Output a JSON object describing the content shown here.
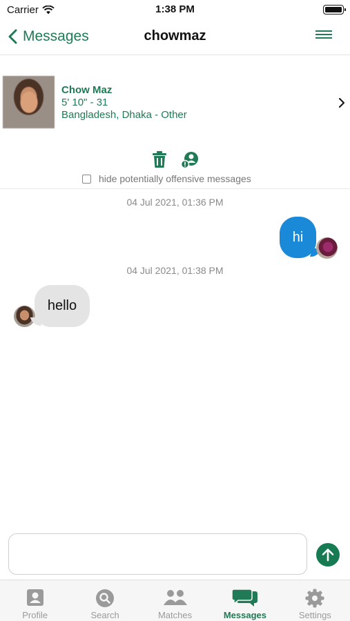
{
  "status_bar": {
    "carrier": "Carrier",
    "time": "1:38 PM"
  },
  "nav": {
    "back_label": "Messages",
    "title": "chowmaz"
  },
  "profile": {
    "name": "Chow Maz",
    "height_age": "5' 10\" - 31",
    "location": "Bangladesh, Dhaka - Other"
  },
  "options": {
    "hide_offensive_label": "hide potentially offensive messages",
    "hide_offensive_checked": false
  },
  "conversation": [
    {
      "timestamp": "04 Jul 2021, 01:36 PM",
      "direction": "outgoing",
      "text": "hi"
    },
    {
      "timestamp": "04 Jul 2021, 01:38 PM",
      "direction": "incoming",
      "text": "hello"
    }
  ],
  "composer": {
    "value": "",
    "placeholder": ""
  },
  "tabs": [
    {
      "label": "Profile",
      "icon": "profile-icon",
      "active": false
    },
    {
      "label": "Search",
      "icon": "search-icon",
      "active": false
    },
    {
      "label": "Matches",
      "icon": "matches-icon",
      "active": false
    },
    {
      "label": "Messages",
      "icon": "messages-icon",
      "active": true
    },
    {
      "label": "Settings",
      "icon": "settings-icon",
      "active": false
    }
  ],
  "colors": {
    "accent": "#1f7a55",
    "outgoing_bubble": "#1a8ad8",
    "incoming_bubble": "#e4e4e4",
    "tab_inactive": "#9a9a9a"
  }
}
